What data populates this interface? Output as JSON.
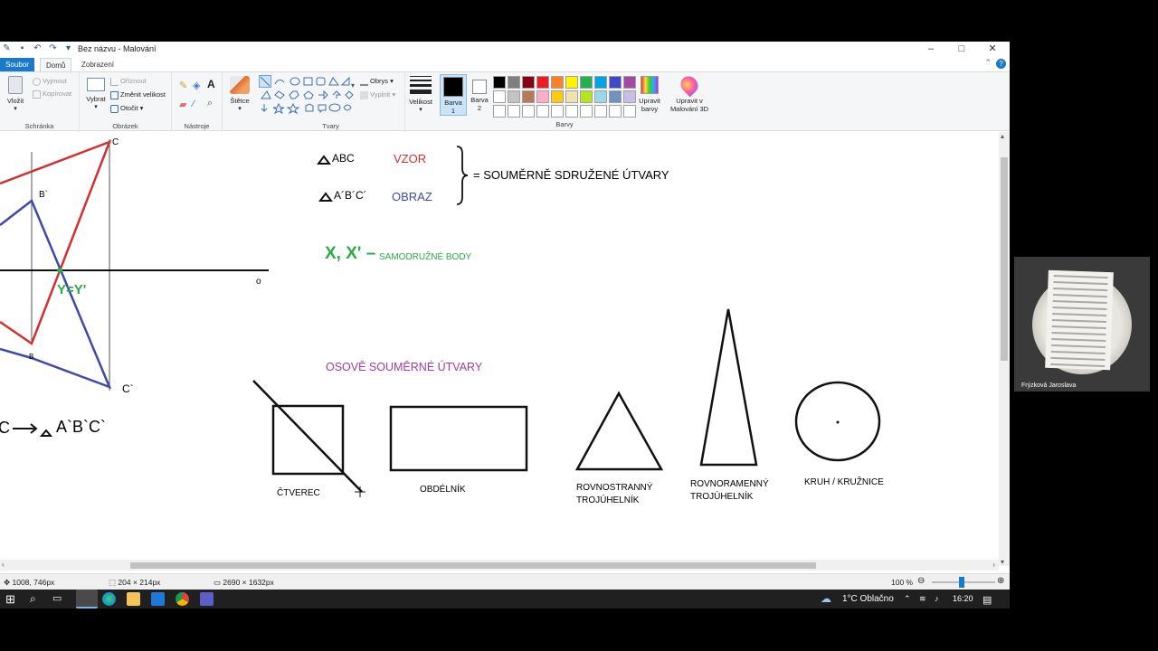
{
  "window": {
    "title": "Bez názvu - Malování",
    "controls": [
      "–",
      "□",
      "✕"
    ]
  },
  "tabs": {
    "file": "Soubor",
    "home": "Domů",
    "view": "Zobrazení"
  },
  "ribbon": {
    "clipboard": {
      "group": "Schránka",
      "paste": "Vložit",
      "cut": "Vyjmout",
      "copy": "Kopírovat"
    },
    "image": {
      "group": "Obrázek",
      "select": "Vybrat",
      "crop": "Oříznout",
      "resize": "Změnit velikost",
      "rotate": "Otočit"
    },
    "tools": {
      "group": "Nástroje"
    },
    "brushes": {
      "label": "Štětce"
    },
    "shapes": {
      "group": "Tvary",
      "outline": "Obrys",
      "fill": "Vyplnit"
    },
    "size": {
      "label": "Velikost"
    },
    "color1": {
      "label": "Barva",
      "num": "1",
      "value": "#000000"
    },
    "color2": {
      "label": "Barva",
      "num": "2",
      "value": "#ffffff"
    },
    "colors": {
      "group": "Barvy",
      "palette": [
        "#000000",
        "#7f7f7f",
        "#880015",
        "#ed1c24",
        "#ff7f27",
        "#fff200",
        "#22b14c",
        "#00a2e8",
        "#3f48cc",
        "#a349a4",
        "#ffffff",
        "#c3c3c3",
        "#b97a57",
        "#ffaec9",
        "#ffc90e",
        "#efe4b0",
        "#b5e61d",
        "#99d9ea",
        "#7092be",
        "#c8bfe7",
        "#ffffff",
        "#ffffff",
        "#ffffff",
        "#ffffff",
        "#ffffff",
        "#ffffff",
        "#ffffff",
        "#ffffff",
        "#ffffff",
        "#ffffff"
      ]
    },
    "edit_colors": {
      "line1": "Upravit",
      "line2": "barvy"
    },
    "paint3d": {
      "line1": "Upravit v",
      "line2": "Malování 3D"
    }
  },
  "canvas": {
    "left_drawing": {
      "label_c": "C",
      "label_b": "B`",
      "label_y": "Y=Y'",
      "label_b2": "B",
      "label_o": "o",
      "label_c2": "C`",
      "bottom_formula_left": "C",
      "bottom_formula_right": "A`B`C`"
    },
    "legend": {
      "triangle1": "ABC",
      "triangle2": "A´B´C´",
      "vzor": "VZOR",
      "obraz": "OBRAZ",
      "equals": "=  SOUMĚRNĚ SDRUŽENÉ ÚTVARY",
      "x_label": "X, X' –",
      "samodruzne": "SAMODRUŽNÉ BODY"
    },
    "heading": "OSOVĚ SOUMĚRNÉ ÚTVARY",
    "shapes": {
      "square": "ČTVEREC",
      "rectangle": "OBDÉLNÍK",
      "equilateral_1": "ROVNOSTRANNÝ",
      "equilateral_2": "TROJÚHELNÍK",
      "isosceles_1": "ROVNORAMENNÝ",
      "isosceles_2": "TROJÚHELNÍK",
      "circle": "KRUH / KRUŽNICE"
    },
    "colors": {
      "red": "#d32f2f",
      "blue": "#3f4aa6",
      "green": "#2eaa44",
      "purple": "#a23b9e"
    }
  },
  "status": {
    "cursor": "1008, 746px",
    "selection": "204 × 214px",
    "canvas_size": "2690 × 1632px",
    "zoom": "100 %"
  },
  "taskbar": {
    "weather": "1°C  Oblačno",
    "time": "16:20"
  },
  "webcam": {
    "name": "Frýzková Jaroslava"
  }
}
